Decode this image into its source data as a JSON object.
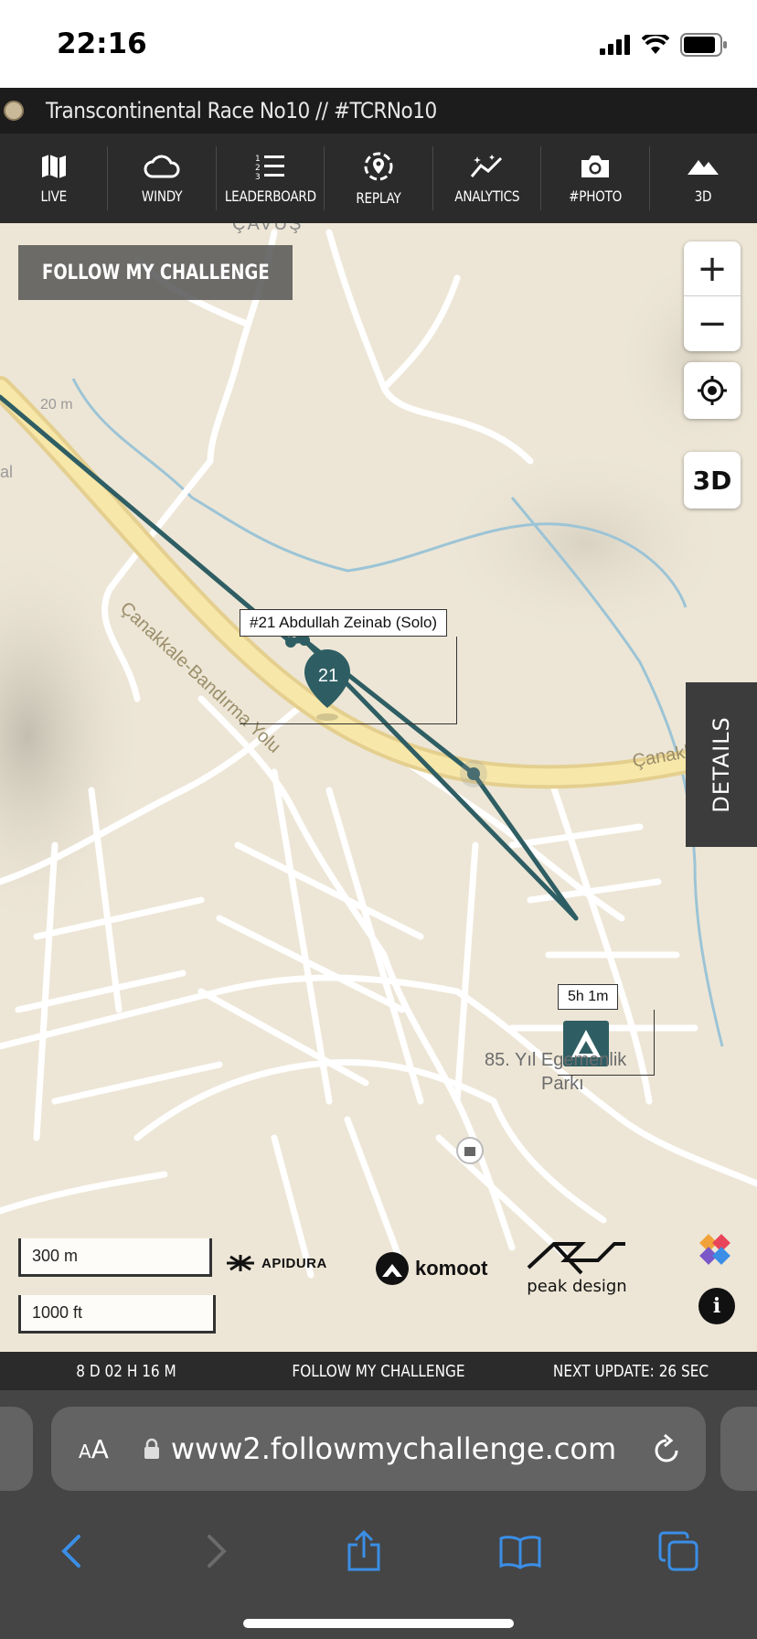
{
  "status_bar": {
    "time": "22:16"
  },
  "race_bar": {
    "title": "Transcontinental Race No10 // #TCRNo10"
  },
  "nav": {
    "items": [
      {
        "label": "LIVE",
        "icon": "map-icon"
      },
      {
        "label": "WINDY",
        "icon": "cloud-icon"
      },
      {
        "label": "LEADERBOARD",
        "icon": "ranked-list-icon"
      },
      {
        "label": "REPLAY",
        "icon": "replay-icon"
      },
      {
        "label": "ANALYTICS",
        "icon": "analytics-icon"
      },
      {
        "label": "#PHOTO",
        "icon": "camera-icon"
      },
      {
        "label": "3D",
        "icon": "mountain-icon"
      }
    ]
  },
  "map": {
    "follow_badge": "FOLLOW MY CHALLENGE",
    "zoom_in": "+",
    "zoom_out": "−",
    "btn_3d": "3D",
    "details_tab": "DETAILS",
    "town_label": "ÇAVUŞ",
    "contour_label": "20 m",
    "edge_label": "al",
    "road_label_a": "Çanakkale-Bandırma Yolu",
    "road_label_b": "Çanakkale-Ba",
    "rider": {
      "label": "#21 Abdullah Zeinab (Solo)",
      "number": "21"
    },
    "camp": {
      "time_label": "5h 1m"
    },
    "place": {
      "line1": "85. Yıl Egemenlik",
      "line2": "Parkı"
    },
    "scale": {
      "metric": "300 m",
      "imperial": "1000 ft"
    },
    "sponsors": {
      "apidura": "APIDURA",
      "komoot": "komoot",
      "peak": "peak design"
    },
    "info_button": "i",
    "route_color": "#2e5e63"
  },
  "bottom_bar": {
    "elapsed": "8 D 02 H 16 M",
    "brand": "FOLLOW MY CHALLENGE",
    "next_update": "NEXT UPDATE: 26 SEC"
  },
  "safari": {
    "aa_label": "AA",
    "url": "www2.followmychallenge.com"
  }
}
